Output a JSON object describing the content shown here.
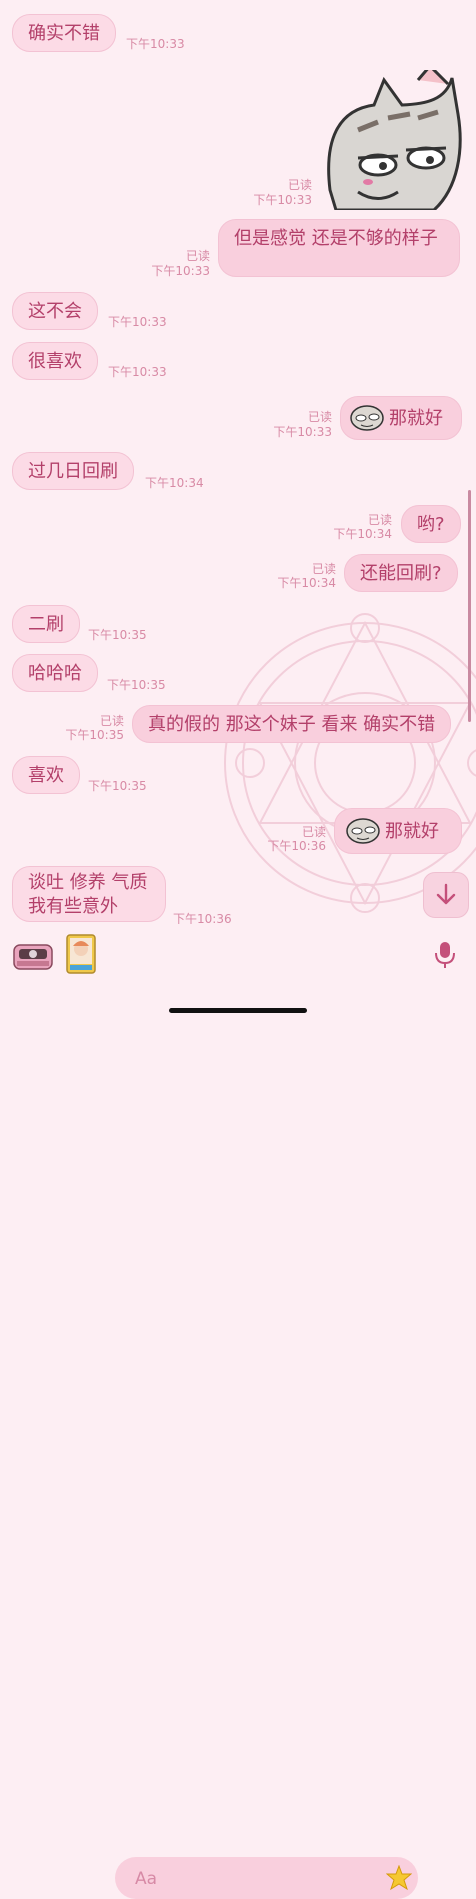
{
  "messages": [
    {
      "text": "确实不错",
      "time": "下午10:33"
    },
    {
      "read": "已读",
      "time": "下午10:33"
    },
    {
      "text": "但是感觉 还是不够的样子",
      "read": "已读",
      "time": "下午10:33"
    },
    {
      "text": "这不会",
      "time": "下午10:33"
    },
    {
      "text": "很喜欢",
      "time": "下午10:33"
    },
    {
      "text": "那就好",
      "read": "已读",
      "time": "下午10:33"
    },
    {
      "text": "过几日回刷",
      "time": "下午10:34"
    },
    {
      "text": "哟?",
      "read": "已读",
      "time": "下午10:34"
    },
    {
      "text": "还能回刷?",
      "read": "已读",
      "time": "下午10:34"
    },
    {
      "text": "二刷",
      "time": "下午10:35"
    },
    {
      "text": "哈哈哈",
      "time": "下午10:35"
    },
    {
      "text": "真的假的 那这个妹子 看来 确实不错",
      "read": "已读",
      "time": "下午10:35"
    },
    {
      "text": "喜欢",
      "time": "下午10:35"
    },
    {
      "text": "那就好",
      "read": "已读",
      "time": "下午10:36"
    },
    {
      "line1": "谈吐 修养 气质",
      "line2": "我有些意外",
      "time": "下午10:36"
    }
  ],
  "composer": {
    "placeholder": "Aa"
  },
  "icons": [
    "camera-icon",
    "sticker-card-icon",
    "emoji-icon",
    "mic-icon",
    "arrow-down-icon"
  ]
}
